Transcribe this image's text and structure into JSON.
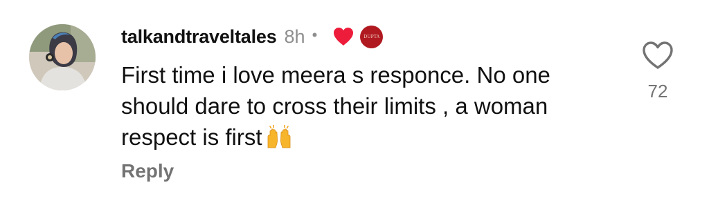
{
  "comment": {
    "username": "talkandtraveltales",
    "timestamp": "8h",
    "separator": "•",
    "creator_liked": true,
    "creator_avatar_text": "DUPTA",
    "text": "First time i love meera s responce. No one should dare to cross their limits , a woman respect is first",
    "emoji": "raising-hands-emoji",
    "reply_label": "Reply",
    "like_icon": "heart-outline-icon",
    "like_count": "72"
  },
  "colors": {
    "text": "#111111",
    "muted": "#8e8e8e",
    "reply": "#737373",
    "heart": "#ed1c3a",
    "creator_avatar_bg": "#b01920"
  }
}
